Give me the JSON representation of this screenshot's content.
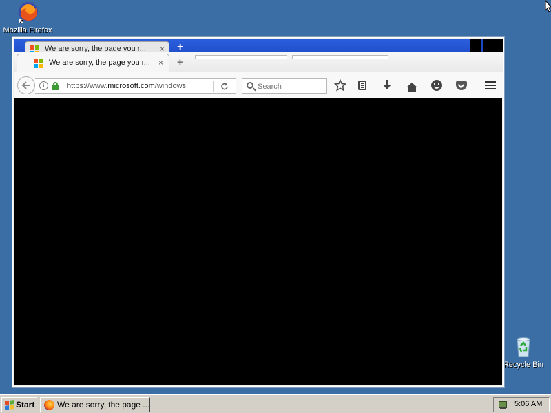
{
  "desktop": {
    "icons": [
      {
        "label": "Mozilla Firefox"
      },
      {
        "label": "Recycle Bin"
      }
    ]
  },
  "browser": {
    "back_tab_title": "We are sorry, the page you r...",
    "tab_title": "We are sorry, the page you r...",
    "tab_close": "×",
    "new_tab": "+",
    "url": {
      "prefix": "https://www.",
      "domain": "microsoft.com",
      "path": "/windows"
    },
    "search_placeholder": "Search",
    "info_glyph": "i"
  },
  "taskbar": {
    "start_label": "Start",
    "task_label": "We are sorry, the page ...",
    "clock": "5:06 AM"
  },
  "colors": {
    "desktop": "#3a6ea5",
    "titlebar": "#1c48c4",
    "lock": "#3d9b35"
  }
}
